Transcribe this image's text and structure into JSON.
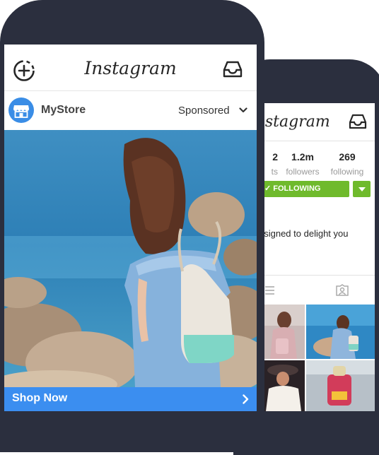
{
  "back_phone": {
    "app_title": "Instagram",
    "stats": [
      {
        "value": "2",
        "label": "ts"
      },
      {
        "value": "1.2m",
        "label": "followers"
      },
      {
        "value": "269",
        "label": "following"
      }
    ],
    "follow_label": "✓ FOLLOWING",
    "bio_text": "esigned to delight you",
    "accent_color": "#6fba2c"
  },
  "front_phone": {
    "app_title": "Instagram",
    "store_name": "MyStore",
    "sponsored_label": "Sponsored",
    "cta_label": "Shop Now",
    "cta_color": "#3b8ef0"
  }
}
